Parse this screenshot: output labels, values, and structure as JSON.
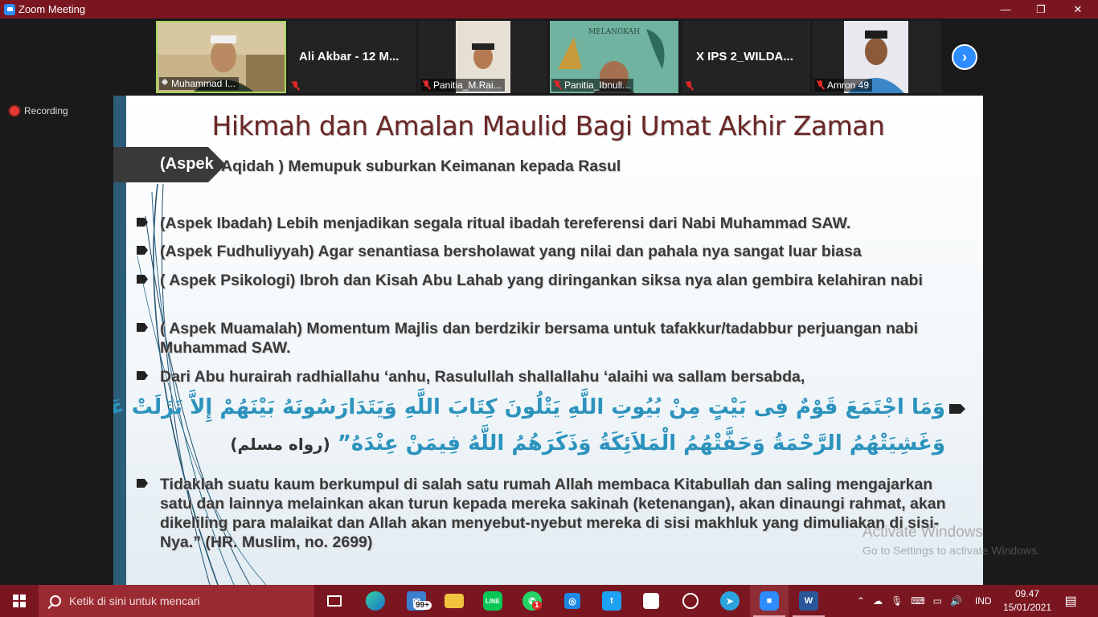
{
  "window": {
    "title": "Zoom Meeting",
    "minimize": "—",
    "maximize": "❐",
    "close": "✕"
  },
  "participants": [
    {
      "name": "Muhammad I..."
    },
    {
      "name": "Ali Akbar - 12 M..."
    },
    {
      "name": "Panitia_M.Rai..."
    },
    {
      "name": "Panitia_Ibnull..."
    },
    {
      "name": "X IPS 2_WILDA..."
    },
    {
      "name": "Amron 49"
    }
  ],
  "thumb_banner": "MELANGKAH",
  "recording": {
    "label": "Recording"
  },
  "slide": {
    "title": "Hikmah dan Amalan Maulid Bagi Umat Akhir Zaman",
    "chevron_text": "(Aspek",
    "first_line": "Aqidah ) Memupuk suburkan Keimanan kepada Rasul",
    "bullets": [
      "(Aspek Ibadah) Lebih menjadikan segala ritual ibadah tereferensi dari Nabi Muhammad SAW.",
      "(Aspek Fudhuliyyah) Agar senantiasa bersholawat yang nilai dan pahala nya sangat luar biasa",
      "( Aspek Psikologi) Ibroh dan Kisah Abu Lahab yang diringankan siksa nya alan gembira kelahiran nabi",
      "( Aspek Muamalah) Momentum Majlis dan berdzikir bersama untuk tafakkur/tadabbur perjuangan nabi Muhammad SAW.",
      "Dari Abu hurairah radhiallahu ‘anhu, Rasulullah shallallahu ‘alaihi wa sallam bersabda,",
      "Tidaklah suatu kaum berkumpul di salah satu rumah Allah membaca Kitabullah dan saling mengajarkan satu dan lainnya melainkan akan turun kepada mereka sakinah (ketenangan), akan dinaungi rahmat, akan dikeliling para malaikat dan Allah akan menyebut-nyebut mereka di sisi makhluk yang dimuliakan di sisi-Nya.” (HR. Muslim, no. 2699)"
    ],
    "arabic_line1": "وَمَا اجْتَمَعَ قَوْمٌ فِى بَيْتٍ مِنْ بُيُوتِ اللَّهِ يَتْلُونَ كِتَابَ اللَّهِ وَيَتَدَارَسُونَهُ بَيْنَهُمْ إِلاَّ نَزَلَتْ عَلَيْهِمُ السَّكِينَةُ",
    "arabic_line2": "وَغَشِيَتْهُمُ الرَّحْمَةُ وَحَفَّتْهُمُ الْمَلاَئِكَةُ وَذَكَرَهُمُ اللَّهُ فِيمَنْ عِنْدَهُ”",
    "arabic_ref": "(رواه مسلم)"
  },
  "activation": {
    "title": "Activate Windows",
    "subtitle": "Go to Settings to activate Windows."
  },
  "taskbar": {
    "search_placeholder": "Ketik di sini untuk mencari",
    "mail_badge": "99+",
    "whatsapp_badge": "1",
    "language": "IND",
    "time": "09.47",
    "date": "15/01/2021",
    "colors": {
      "bar": "#7a1620",
      "search": "#9a2b33"
    }
  },
  "colors": {
    "zoom_blue": "#2d8cff",
    "title_text": "#6b2626",
    "arabic_text": "#2c93bd"
  }
}
